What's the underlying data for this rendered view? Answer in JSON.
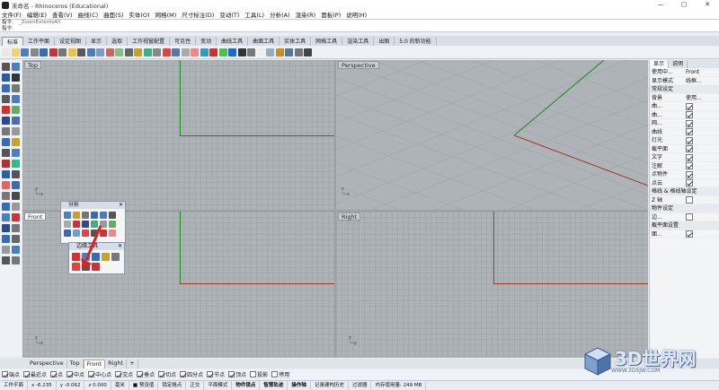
{
  "window": {
    "title": "未命名 - Rhinoceros (Educational)",
    "controls": [
      "—",
      "▢",
      "✕"
    ]
  },
  "menu": [
    "文件(F)",
    "编辑(E)",
    "查看(V)",
    "曲线(C)",
    "曲面(S)",
    "实体(O)",
    "网格(M)",
    "尺寸标注(D)",
    "变动(T)",
    "工具(L)",
    "分析(A)",
    "渲染(R)",
    "面板(P)",
    "说明(H)"
  ],
  "command": {
    "prefix": "指令:",
    "history": "_ZoomExtentsAll",
    "prompt": "指令:"
  },
  "tabs": [
    "标准",
    "工作平面",
    "设定视图",
    "显示",
    "选取",
    "工作视窗配置",
    "可见性",
    "变动",
    "曲线工具",
    "曲面工具",
    "实体工具",
    "网格工具",
    "渲染工具",
    "出图",
    "5.0 的新功能"
  ],
  "toolbar_colors": [
    "#e8e8e8",
    "#f1d36b",
    "#4a7fc4",
    "#888",
    "#3a6ab0",
    "#c33",
    "#777",
    "#e9c34f",
    "#5a5a5a",
    "#4b7bc0",
    "#7a9ccc",
    "#c66",
    "#8b8",
    "#666",
    "#c8a030",
    "#4a8",
    "#888",
    "#d44",
    "#5577aa",
    "#aaa",
    "#e88",
    "#39c",
    "#c33",
    "#5b5",
    "#26c",
    "#333",
    "#777",
    "#eee",
    "#9ab",
    "#cc8a2a",
    "#579",
    "#777",
    "#444"
  ],
  "left_tool_colors": [
    "#555",
    "#4a7fc4",
    "#2c5aa0",
    "#333",
    "#3a6ab0",
    "#777",
    "#5a5a5a",
    "#4b7bc0",
    "#c33",
    "#6a6",
    "#2a4a8a",
    "#4d6fa8",
    "#777",
    "#999",
    "#3a6ab0",
    "#c8a030",
    "#555",
    "#4a7fc4",
    "#a33",
    "#3b8",
    "#2e5fa0",
    "#555",
    "#d66",
    "#3a6ab0",
    "#777",
    "#4a4a4a",
    "#3a6ab0",
    "#999",
    "#4a7fc4",
    "#c33",
    "#2a4a8a",
    "#777",
    "#3a6ab0",
    "#666",
    "#999",
    "#4a7fc4",
    "#555",
    "#777"
  ],
  "viewports": {
    "top": {
      "label": "Top"
    },
    "perspective": {
      "label": "Perspective"
    },
    "front": {
      "label": "Front"
    },
    "right": {
      "label": "Right"
    }
  },
  "float_analysis": {
    "title": "分析",
    "close": "✕"
  },
  "float_edge": {
    "title": "边缘工具",
    "close": "✕"
  },
  "panel": {
    "tabs": [
      "显示",
      "说明"
    ],
    "rows": [
      {
        "k": "使用中...",
        "v": "Front"
      },
      {
        "k": "显示模式",
        "v": "线框..."
      },
      {
        "sec": "常规设定"
      },
      {
        "k": "背景",
        "v": "使用..."
      },
      {
        "k": "曲...",
        "chk": true
      },
      {
        "k": "曲...",
        "chk": true
      },
      {
        "k": "网...",
        "chk": true
      },
      {
        "k": "曲线",
        "chk": true
      },
      {
        "k": "灯光",
        "chk": true
      },
      {
        "k": "截平面",
        "chk": true
      },
      {
        "k": "文字",
        "chk": true
      },
      {
        "k": "注解",
        "chk": true
      },
      {
        "k": "点物件",
        "chk": true
      },
      {
        "k": "点云",
        "chk": true
      },
      {
        "sec": "格线 & 格线轴设定"
      },
      {
        "k": "Z 轴",
        "chk": false
      },
      {
        "sec": "物件设定"
      },
      {
        "k": "边...",
        "chk": false
      },
      {
        "sec": "截平面设置"
      },
      {
        "k": "面...",
        "chk": true
      }
    ]
  },
  "vp_tabs": [
    "Perspective",
    "Top",
    "Front",
    "Right",
    "+"
  ],
  "osnaps": [
    {
      "label": "端点",
      "on": true
    },
    {
      "label": "最近点",
      "on": true
    },
    {
      "label": "点",
      "on": true
    },
    {
      "label": "中点",
      "on": true
    },
    {
      "label": "中心点",
      "on": true
    },
    {
      "label": "交点",
      "on": true
    },
    {
      "label": "垂点",
      "on": true
    },
    {
      "label": "切点",
      "on": true
    },
    {
      "label": "四分点",
      "on": true
    },
    {
      "label": "节点",
      "on": true
    },
    {
      "label": "顶点",
      "on": true
    },
    {
      "label": "投影",
      "on": false
    },
    {
      "label": "停用",
      "on": false
    }
  ],
  "status": [
    {
      "t": "工作平面"
    },
    {
      "t": "x -6.235"
    },
    {
      "t": "y -0.062"
    },
    {
      "t": "z 0.000"
    },
    {
      "t": "毫米"
    },
    {
      "t": "■ 预设值"
    },
    {
      "t": "锁定格点"
    },
    {
      "t": "正交"
    },
    {
      "t": "平面模式"
    },
    {
      "t": "物件锁点",
      "b": true
    },
    {
      "t": "智慧轨迹",
      "b": true
    },
    {
      "t": "操作轴",
      "b": true
    },
    {
      "t": "记录建构历史"
    },
    {
      "t": "过滤器"
    },
    {
      "t": "内存使用量: 249 MB"
    }
  ],
  "watermark": {
    "text": "3D世界网",
    "url": "WWW.3DSJW.COM"
  }
}
